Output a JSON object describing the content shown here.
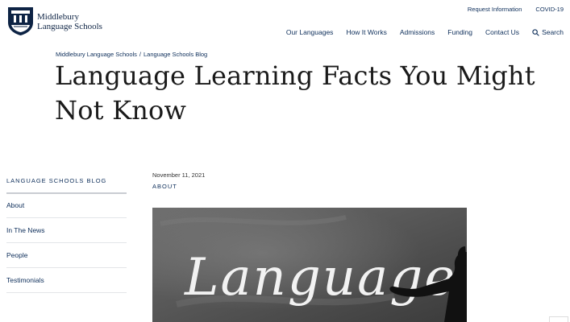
{
  "brand": {
    "line1": "Middlebury",
    "line2": "Language Schools",
    "colors": {
      "navy": "#0d2344",
      "link": "#0d2e5a"
    }
  },
  "utility_nav": [
    "Request Information",
    "COVID-19"
  ],
  "main_nav": [
    "Our Languages",
    "How It Works",
    "Admissions",
    "Funding",
    "Contact Us"
  ],
  "search_label": "Search",
  "breadcrumb": [
    "Middlebury Language Schools",
    "Language Schools Blog"
  ],
  "breadcrumb_sep": "/",
  "title": "Language Learning Facts You Might Not Know",
  "sidebar": {
    "heading": "LANGUAGE SCHOOLS BLOG",
    "items": [
      "About",
      "In The News",
      "People",
      "Testimonials"
    ]
  },
  "article": {
    "date": "November 11, 2021",
    "category": "ABOUT"
  },
  "hero_image": {
    "word": "Language",
    "icon": "chalkboard-photo"
  }
}
